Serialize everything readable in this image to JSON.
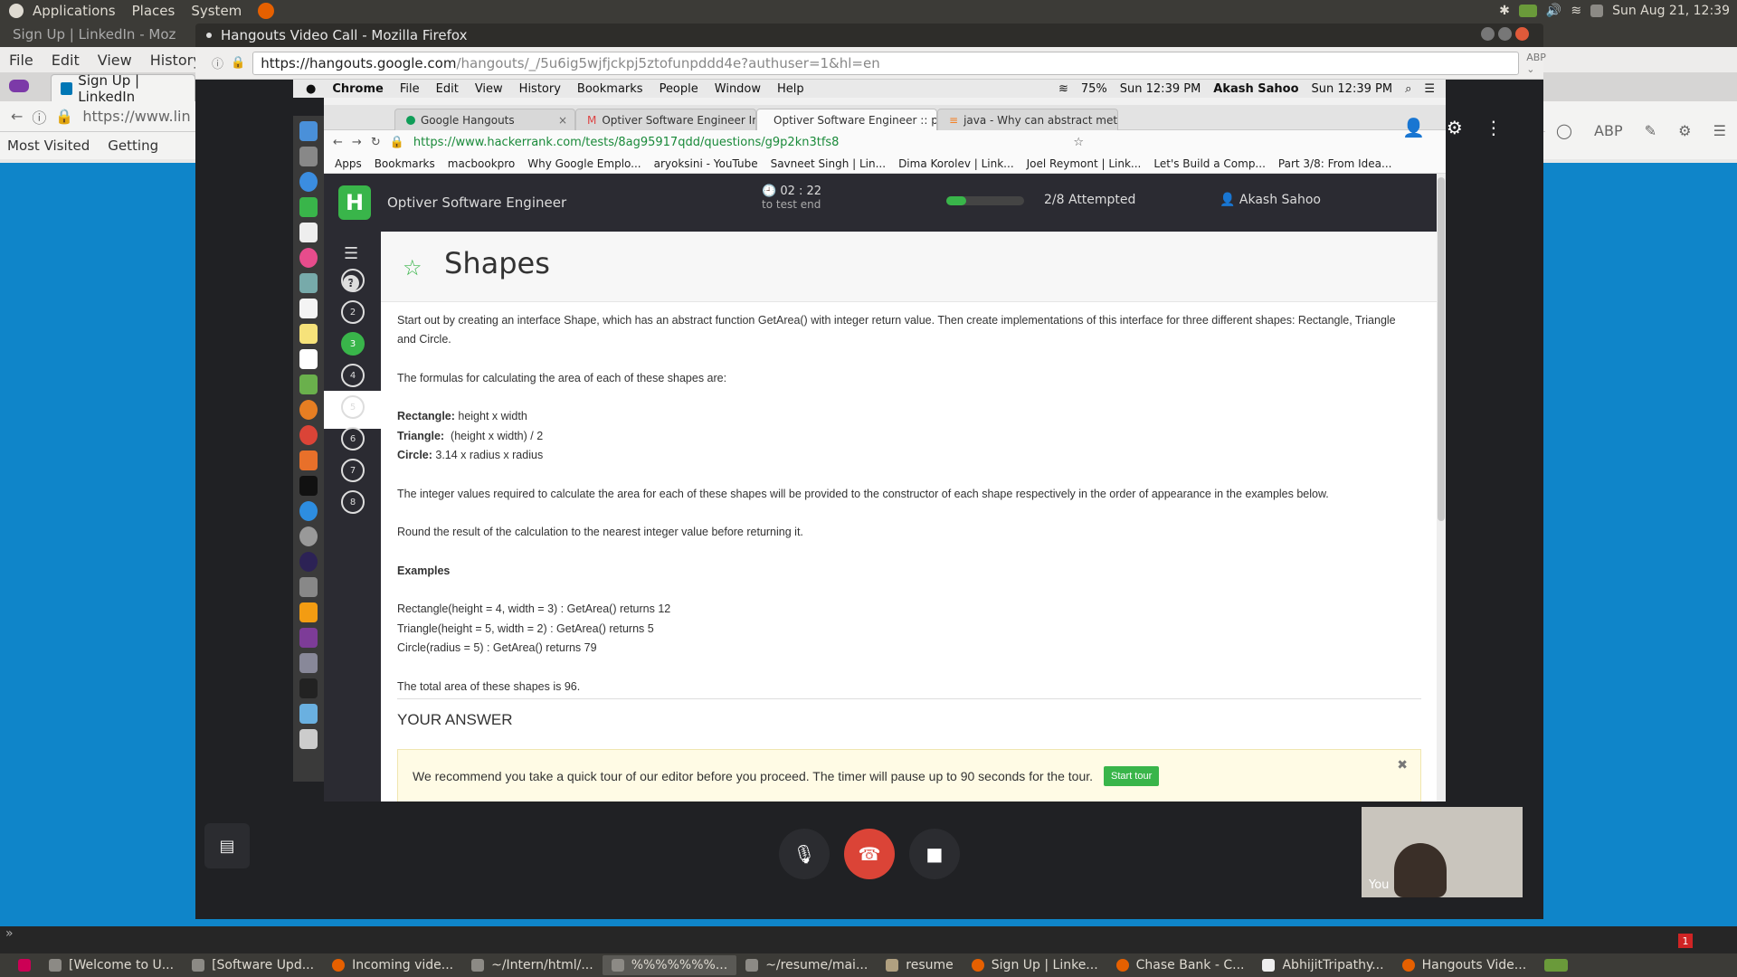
{
  "top_panel": {
    "menu": [
      "Applications",
      "Places",
      "System"
    ],
    "clock": "Sun Aug 21, 12:39"
  },
  "bg_firefox": {
    "title": "Sign Up | LinkedIn - Moz",
    "menu": [
      "File",
      "Edit",
      "View",
      "History"
    ],
    "tab_label": "Sign Up | LinkedIn",
    "url": "https://www.lin",
    "bookmarks": [
      "Most Visited",
      "Getting"
    ]
  },
  "hangouts_window": {
    "title": "Hangouts Video Call - Mozilla Firefox",
    "url_host": "https://hangouts.google.com",
    "url_path": "/hangouts/_/5u6ig5wjfjckpj5ztofunpddd4e?authuser=1&hl=en"
  },
  "mac_menubar": {
    "app": "Chrome",
    "items": [
      "File",
      "Edit",
      "View",
      "History",
      "Bookmarks",
      "People",
      "Window",
      "Help"
    ],
    "battery": "75%",
    "time": "Sun 12:39 PM",
    "user": "Akash Sahoo",
    "time2": "Sun 12:39 PM"
  },
  "chrome": {
    "tabs": [
      {
        "label": "Google Hangouts"
      },
      {
        "label": "Optiver Software Engineer Inv"
      },
      {
        "label": "Optiver Software Engineer :: p"
      },
      {
        "label": "java - Why can abstract meth"
      }
    ],
    "url": "https://www.hackerrank.com/tests/8ag95917qdd/questions/g9p2kn3tfs8",
    "bookmarks": [
      "Apps",
      "Bookmarks",
      "macbookpro",
      "Why Google Emplo...",
      "aryoksini - YouTube",
      "Savneet Singh | Lin...",
      "Dima Korolev | Link...",
      "Joel Reymont | Link...",
      "Let's Build a Comp...",
      "Part 3/8: From Idea..."
    ]
  },
  "hackerrank": {
    "logo": "H",
    "test_title": "Optiver Software Engineer",
    "timer": "02 : 22",
    "timer_label": "to test end",
    "progress": 0.25,
    "attempted": "2/8 Attempted",
    "user": "Akash Sahoo",
    "questions": [
      "1",
      "2",
      "3",
      "4",
      "5",
      "6",
      "7",
      "8"
    ],
    "current_question": "3",
    "problem_title": "Shapes",
    "description": {
      "intro": "Start out by creating an interface Shape, which has an abstract function GetArea() with integer return value. Then create implementations of this interface for three different shapes: Rectangle, Triangle and Circle.",
      "formulas_intro": "The formulas for calculating the area of each of these shapes are:",
      "rect_label": "Rectangle:",
      "rect_formula": " height x width",
      "tri_label": "Triangle:",
      "tri_formula": "  (height x width) / 2",
      "circle_label": "Circle:",
      "circle_formula": " 3.14 x radius x radius",
      "constructor_note": "The integer values required to calculate the area for each of these shapes will be provided to the constructor of each shape respectively in the order of appearance in the examples below.",
      "round_note": "Round the result of the calculation to the nearest integer value before returning it.",
      "examples_heading": "Examples",
      "example1": "Rectangle(height = 4, width = 3) : GetArea() returns 12",
      "example2": "Triangle(height = 5, width = 2) : GetArea() returns 5",
      "example3": "Circle(radius = 5) : GetArea() returns 79",
      "total": "The total area of these shapes is 96."
    },
    "answer_heading": "YOUR ANSWER",
    "tour_message": "We recommend you take a quick tour of our editor before you proceed. The timer will pause up to 90 seconds for the tour.",
    "tour_button": "Start tour"
  },
  "hangouts_controls": {
    "self_label": "You"
  },
  "taskbar": {
    "items": [
      "[Welcome to U...",
      "[Software Upd...",
      "Incoming vide...",
      "~/Intern/html/...",
      "%%%%%%%...",
      "~/resume/mai...",
      "resume",
      "Sign Up | Linke...",
      "Chase Bank - C...",
      "AbhijitTripathy...",
      "Hangouts Vide..."
    ],
    "badge": "1"
  }
}
